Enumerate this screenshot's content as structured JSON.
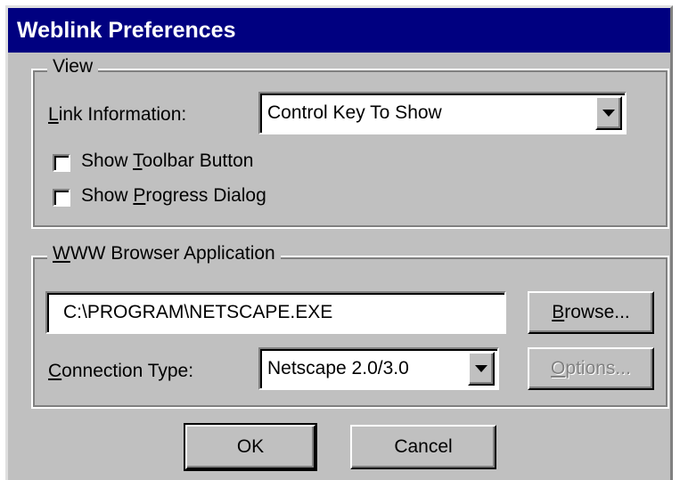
{
  "window": {
    "title": "Weblink Preferences"
  },
  "view_group": {
    "legend": "View",
    "link_info_label_u": "L",
    "link_info_label_rest": "ink Information:",
    "link_info_value": "Control Key To Show",
    "show_toolbar_pre": "Show ",
    "show_toolbar_u": "T",
    "show_toolbar_post": "oolbar Button",
    "show_toolbar_checked": false,
    "show_progress_pre": "Show ",
    "show_progress_u": "P",
    "show_progress_post": "rogress Dialog",
    "show_progress_checked": false
  },
  "browser_group": {
    "legend_u": "W",
    "legend_rest": "WW Browser Application",
    "path_value": "C:\\PROGRAM\\NETSCAPE.EXE",
    "browse_u": "B",
    "browse_rest": "rowse...",
    "connection_label_u": "C",
    "connection_label_rest": "onnection Type:",
    "connection_value": "Netscape 2.0/3.0",
    "options_u": "O",
    "options_rest": "ptions..."
  },
  "buttons": {
    "ok": "OK",
    "cancel": "Cancel"
  }
}
